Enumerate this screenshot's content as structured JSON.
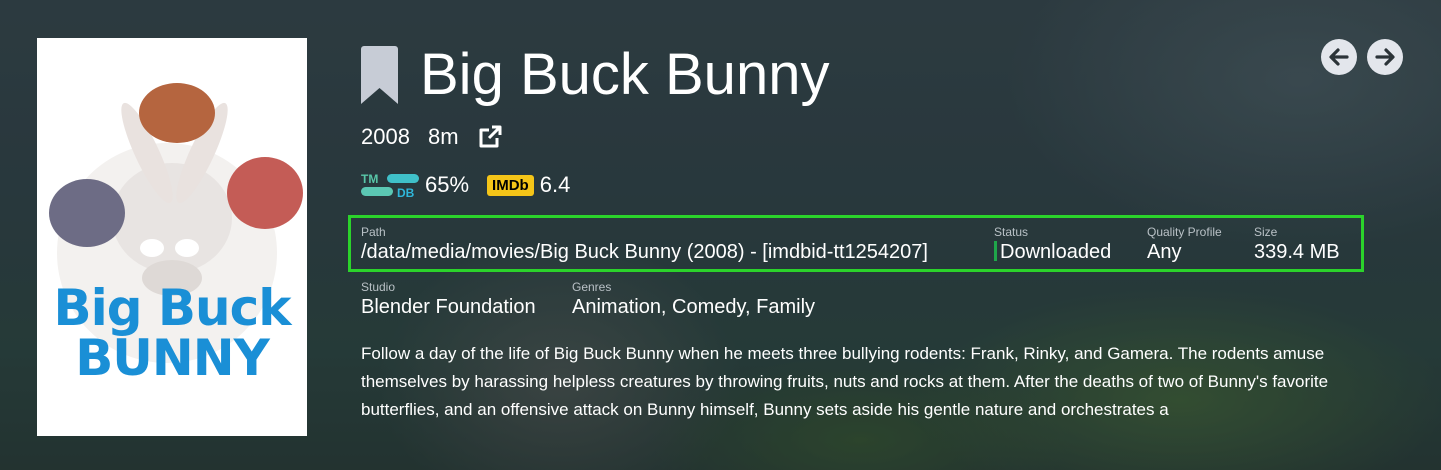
{
  "movie": {
    "title": "Big Buck Bunny",
    "year": "2008",
    "runtime": "8m",
    "poster_title_line1": "Big Buck",
    "poster_title_line2": "BUNNY"
  },
  "ratings": {
    "tmdb_score": "65%",
    "imdb_label": "IMDb",
    "imdb_score": "6.4"
  },
  "details": {
    "path_label": "Path",
    "path_value": "/data/media/movies/Big Buck Bunny (2008) - [imdbid-tt1254207]",
    "status_label": "Status",
    "status_value": "Downloaded",
    "quality_label": "Quality Profile",
    "quality_value": "Any",
    "size_label": "Size",
    "size_value": "339.4 MB"
  },
  "info": {
    "studio_label": "Studio",
    "studio_value": "Blender Foundation",
    "genres_label": "Genres",
    "genres_value": "Animation, Comedy, Family"
  },
  "overview": "Follow a day of the life of Big Buck Bunny when he meets three bullying rodents: Frank, Rinky, and Gamera. The rodents amuse themselves by harassing helpless creatures by throwing fruits, nuts and rocks at them. After the deaths of two of Bunny's favorite butterflies, and an offensive attack on Bunny himself, Bunny sets aside his gentle nature and orchestrates a",
  "icons": {
    "bookmark": "bookmark-icon",
    "external": "external-link-icon",
    "prev": "arrow-left-icon",
    "next": "arrow-right-icon"
  },
  "colors": {
    "highlight_border": "#2bd32b",
    "status_downloaded": "#1fa64a",
    "imdb": "#f5c518",
    "tmdb": "#01b4e4"
  }
}
